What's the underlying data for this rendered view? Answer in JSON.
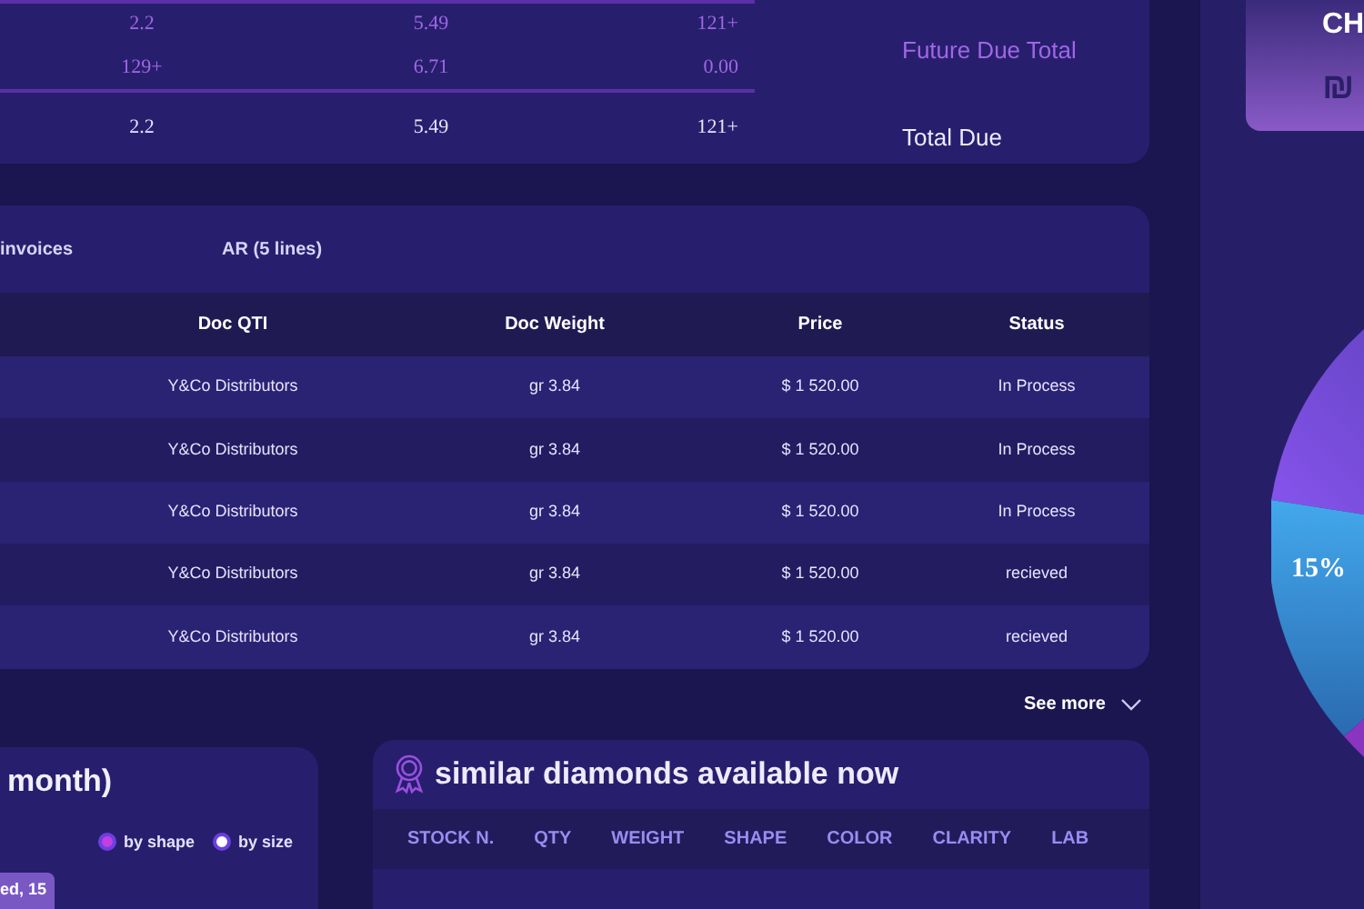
{
  "totals_card": {
    "future_rows": [
      [
        "2.2",
        "5.49",
        "121+"
      ],
      [
        "129+",
        "6.71",
        "0.00"
      ]
    ],
    "future_label": "Future Due Total",
    "total_row": [
      "2.2",
      "5.49",
      "121+"
    ],
    "total_label": "Total Due"
  },
  "invoice_card": {
    "tabs": [
      {
        "label": "invoices"
      },
      {
        "label": "AR (5 lines)"
      }
    ],
    "columns": [
      "Doc QTI",
      "Doc Weight",
      "Price",
      "Status"
    ],
    "rows": [
      [
        "Y&Co Distributors",
        "gr 3.84",
        "$ 1 520.00",
        "In Process"
      ],
      [
        "Y&Co Distributors",
        "gr 3.84",
        "$ 1 520.00",
        "In Process"
      ],
      [
        "Y&Co Distributors",
        "gr 3.84",
        "$ 1 520.00",
        "In Process"
      ],
      [
        "Y&Co Distributors",
        "gr 3.84",
        "$ 1 520.00",
        "recieved"
      ],
      [
        "Y&Co Distributors",
        "gr 3.84",
        "$ 1 520.00",
        "recieved"
      ]
    ],
    "see_more": "See more"
  },
  "month_card": {
    "title": "month)",
    "legend": [
      {
        "label": "by shape",
        "color": "#c23fe3"
      },
      {
        "label": "by size",
        "color": "#ffffff"
      }
    ],
    "date_tag": "ed, 15"
  },
  "diamonds_card": {
    "title": "similar diamonds available now",
    "columns": [
      "STOCK N.",
      "QTY",
      "WEIGHT",
      "SHAPE",
      "COLOR",
      "CLARITY",
      "LAB"
    ]
  },
  "side_panel": {
    "summary_card": {
      "line_1": "CH",
      "line_2": "₪"
    },
    "pie_label": "15%"
  }
}
